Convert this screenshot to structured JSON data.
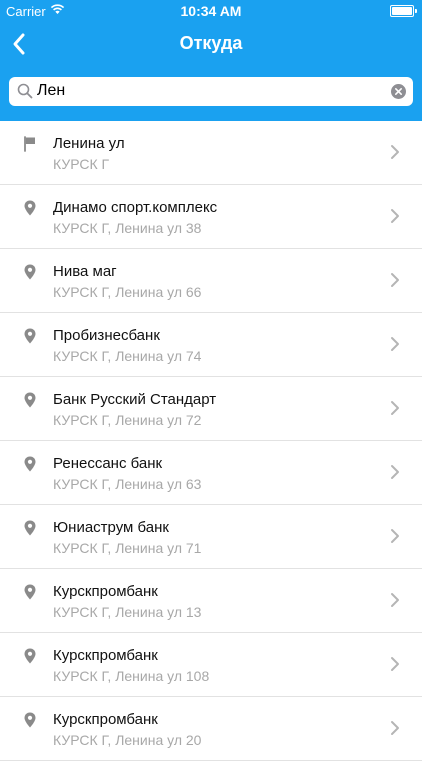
{
  "status": {
    "carrier": "Carrier",
    "time": "10:34 AM"
  },
  "nav": {
    "title": "Откуда"
  },
  "search": {
    "value": "Лен"
  },
  "colors": {
    "accent": "#1aa1f0"
  },
  "list": [
    {
      "icon": "flag-icon",
      "name": "Ленина ул",
      "address": "КУРСК Г"
    },
    {
      "icon": "location-pin-icon",
      "name": "Динамо спорт.комплекс",
      "address": "КУРСК Г, Ленина ул 38"
    },
    {
      "icon": "location-pin-icon",
      "name": "Нива маг",
      "address": "КУРСК Г, Ленина ул 66"
    },
    {
      "icon": "location-pin-icon",
      "name": "Пробизнесбанк",
      "address": "КУРСК Г, Ленина ул 74"
    },
    {
      "icon": "location-pin-icon",
      "name": "Банк Русский Стандарт",
      "address": "КУРСК Г, Ленина ул 72"
    },
    {
      "icon": "location-pin-icon",
      "name": "Ренессанс банк",
      "address": "КУРСК Г, Ленина ул 63"
    },
    {
      "icon": "location-pin-icon",
      "name": "Юниаструм банк",
      "address": "КУРСК Г, Ленина ул 71"
    },
    {
      "icon": "location-pin-icon",
      "name": "Курскпромбанк",
      "address": "КУРСК Г, Ленина ул 13"
    },
    {
      "icon": "location-pin-icon",
      "name": "Курскпромбанк",
      "address": "КУРСК Г, Ленина ул 108"
    },
    {
      "icon": "location-pin-icon",
      "name": "Курскпромбанк",
      "address": "КУРСК Г, Ленина ул 20"
    }
  ]
}
